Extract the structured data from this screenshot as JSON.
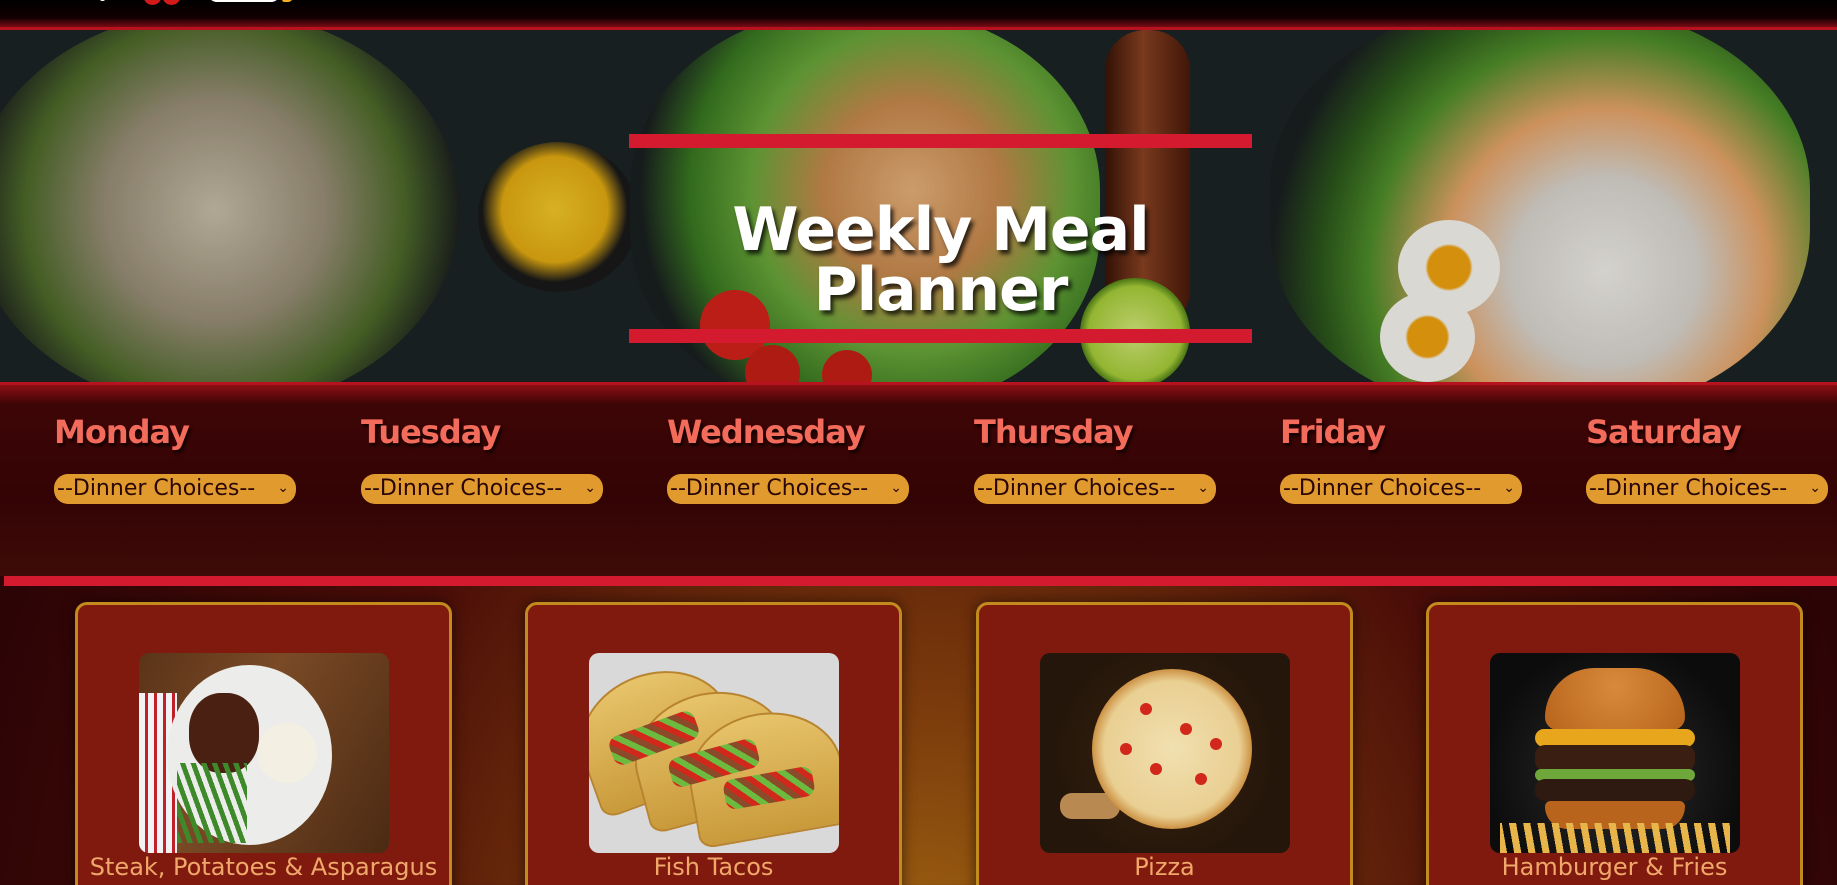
{
  "header": {
    "logo": "brand-logo"
  },
  "hero": {
    "title": "Weekly Meal Planner",
    "image": "food-banner-image"
  },
  "planner": {
    "days": [
      {
        "label": "Monday",
        "selected": "--Dinner Choices--"
      },
      {
        "label": "Tuesday",
        "selected": "--Dinner Choices--"
      },
      {
        "label": "Wednesday",
        "selected": "--Dinner Choices--"
      },
      {
        "label": "Thursday",
        "selected": "--Dinner Choices--"
      },
      {
        "label": "Friday",
        "selected": "--Dinner Choices--"
      },
      {
        "label": "Saturday",
        "selected": "--Dinner Choices--"
      }
    ],
    "chevron": "chevron-down-icon"
  },
  "meals": [
    {
      "title": "Steak, Potatoes & Asparagus",
      "image": "steak-photo"
    },
    {
      "title": "Fish Tacos",
      "image": "fish-tacos-photo"
    },
    {
      "title": "Pizza",
      "image": "pizza-photo"
    },
    {
      "title": "Hamburger & Fries",
      "image": "hamburger-photo"
    }
  ],
  "colors": {
    "accent_red": "#d41a2e",
    "day_label": "#f26b5b",
    "select_bg": "#e09a2e",
    "card_bg": "#811a0e",
    "card_border": "#c38a1d",
    "card_title": "#f0a86a"
  }
}
